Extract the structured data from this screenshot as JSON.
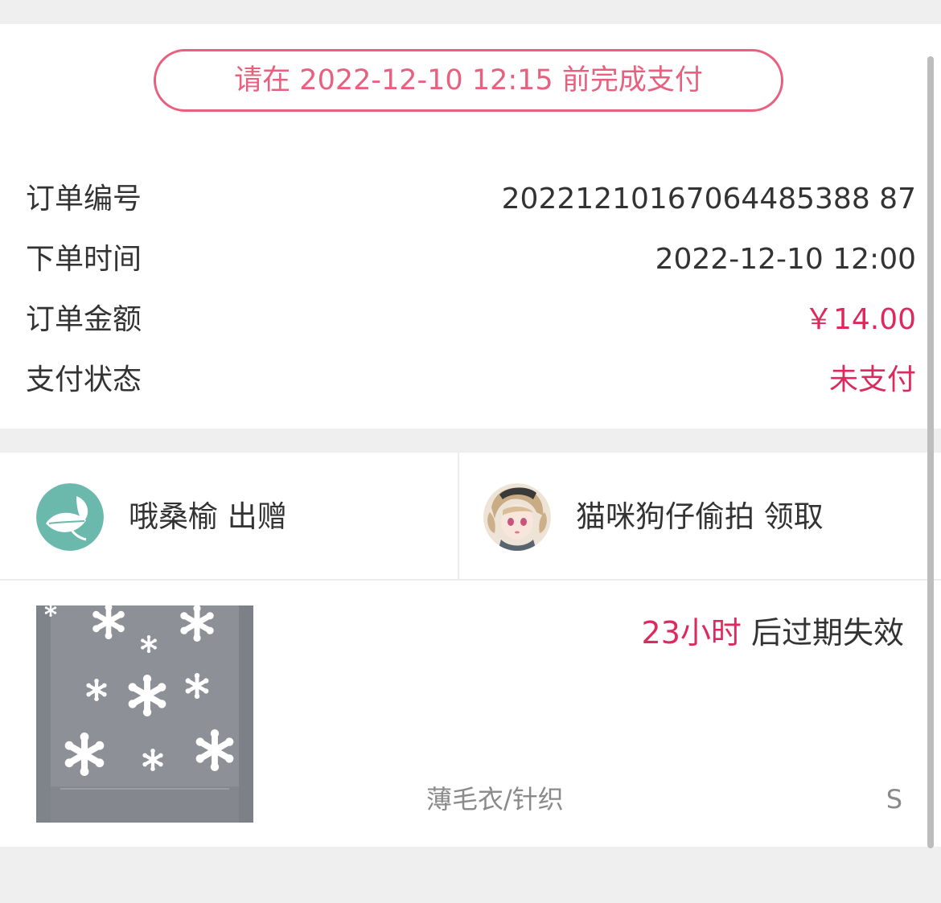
{
  "order": {
    "deadline_text": "请在 2022-12-10 12:15 前完成支付",
    "rows": [
      {
        "label": "订单编号",
        "value": "20221210167064485388 87"
      },
      {
        "label": "下单时间",
        "value": "2022-12-10 12:00"
      },
      {
        "label": "订单金额",
        "value": "￥14.00"
      },
      {
        "label": "支付状态",
        "value": "未支付"
      }
    ]
  },
  "transfer": {
    "giver": {
      "name_action": "哦桑榆 出赠",
      "avatar_icon": "leaf-avatar"
    },
    "receiver": {
      "name_action": "猫咪狗仔偷拍 领取",
      "avatar_icon": "anime-girl-avatar"
    }
  },
  "item": {
    "expire_hours": "23小时",
    "expire_suffix": " 后过期失效",
    "category": "薄毛衣/针织",
    "size": "S",
    "image_icon": "snowflake-sweater-photo"
  },
  "colors": {
    "accent": "#dc2a5f",
    "pill_border": "#e8607e",
    "leaf_avatar": "#6bb8ad"
  }
}
